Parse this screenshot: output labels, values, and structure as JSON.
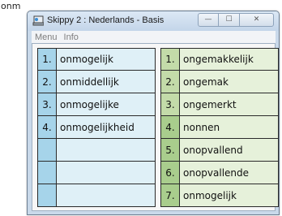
{
  "typed_text": "onm",
  "window": {
    "title": "Skippy 2 : Nederlands - Basis",
    "controls": {
      "minimize": "—",
      "maximize": "☐",
      "close": "✕"
    },
    "icon": "app-icon"
  },
  "menu": {
    "items": [
      "Menu",
      "Info"
    ]
  },
  "left_list": {
    "rows": [
      {
        "num": "1.",
        "word": "onmogelijk"
      },
      {
        "num": "2.",
        "word": "onmiddellijk"
      },
      {
        "num": "3.",
        "word": "onmogelijke"
      },
      {
        "num": "4.",
        "word": "onmogelijkheid"
      },
      {
        "num": "",
        "word": ""
      },
      {
        "num": "",
        "word": ""
      },
      {
        "num": "",
        "word": ""
      }
    ]
  },
  "right_list": {
    "rows": [
      {
        "num": "1.",
        "word": "ongemakkelijk"
      },
      {
        "num": "2.",
        "word": "ongemak"
      },
      {
        "num": "3.",
        "word": "ongemerkt"
      },
      {
        "num": "4.",
        "word": "nonnen"
      },
      {
        "num": "5.",
        "word": "onopvallend"
      },
      {
        "num": "6.",
        "word": "onopvallende"
      },
      {
        "num": "7.",
        "word": "onmogelijk"
      }
    ]
  },
  "colors": {
    "left_num": "#a6d4ea",
    "left_word": "#dff0f7",
    "right_num": "#c3dba9",
    "right_word": "#e6f1da"
  }
}
